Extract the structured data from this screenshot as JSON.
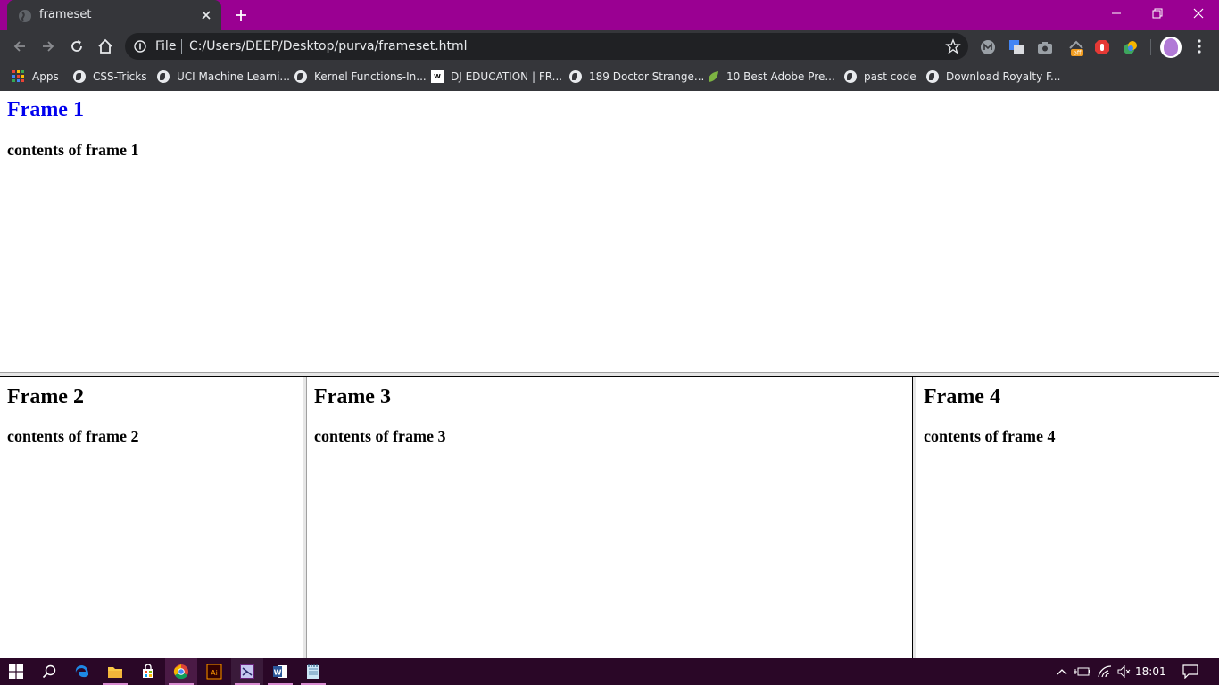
{
  "browser": {
    "tab_title": "frameset",
    "address": {
      "site_chip": "File",
      "url": "C:/Users/DEEP/Desktop/purva/frameset.html"
    },
    "bookmarks": [
      {
        "label": "Apps",
        "icon": "apps-grid-icon"
      },
      {
        "label": "CSS-Tricks",
        "icon": "globe-icon"
      },
      {
        "label": "UCI Machine Learni...",
        "icon": "globe-icon"
      },
      {
        "label": "Kernel Functions-In...",
        "icon": "globe-icon"
      },
      {
        "label": "DJ EDUCATION | FR...",
        "icon": "wix-icon"
      },
      {
        "label": "189 Doctor Strange...",
        "icon": "globe-icon"
      },
      {
        "label": "10 Best Adobe Pre...",
        "icon": "leaf-icon"
      },
      {
        "label": "past code",
        "icon": "globe-icon"
      },
      {
        "label": "Download Royalty F...",
        "icon": "globe-icon"
      }
    ],
    "extensions_badge": "off"
  },
  "frames": [
    {
      "heading": "Frame 1",
      "body": "contents of frame 1",
      "bg": "#cfc3c6",
      "heading_color": "#0000ee"
    },
    {
      "heading": "Frame 2",
      "body": "contents of frame 2",
      "bg": "#ffffff",
      "heading_color": "#000000"
    },
    {
      "heading": "Frame 3",
      "body": "contents of frame 3",
      "bg": "#ffffff",
      "heading_color": "#000000"
    },
    {
      "heading": "Frame 4",
      "body": "contents of frame 4",
      "bg": "#ffffff",
      "heading_color": "#000000"
    }
  ],
  "taskbar": {
    "clock": "18:01",
    "apps": [
      "start-icon",
      "search-icon",
      "edge-icon",
      "file-explorer-icon",
      "store-icon",
      "chrome-icon",
      "illustrator-icon",
      "visual-studio-icon",
      "word-icon",
      "notepad-icon"
    ]
  },
  "colors": {
    "title_bar": "#9a0092",
    "toolbar": "#35363a",
    "taskbar": "#2a0727"
  }
}
